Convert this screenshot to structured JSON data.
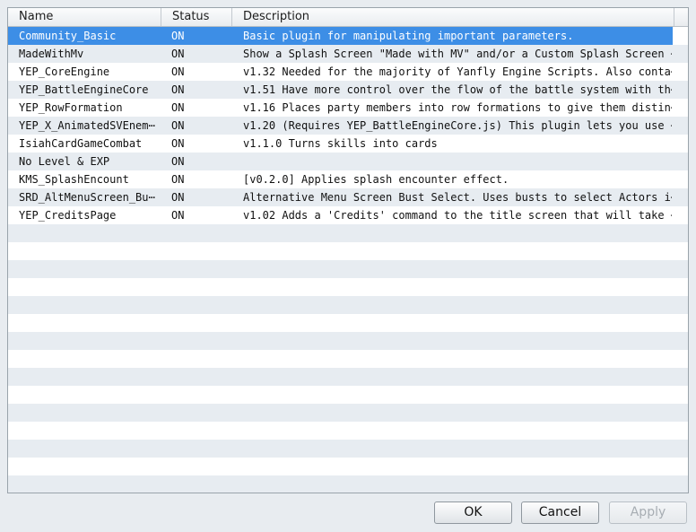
{
  "columns": {
    "name": "Name",
    "status": "Status",
    "description": "Description"
  },
  "plugins": [
    {
      "name": "Community_Basic",
      "status": "ON",
      "description": "Basic plugin for manipulating important parameters.",
      "selected": true
    },
    {
      "name": "MadeWithMv",
      "status": "ON",
      "description": "Show a Splash Screen \"Made with MV\" and/or a Custom Splash Screen ⋯"
    },
    {
      "name": "YEP_CoreEngine",
      "status": "ON",
      "description": "v1.32 Needed for the majority of Yanfly Engine Scripts. Also conta⋯"
    },
    {
      "name": "YEP_BattleEngineCore",
      "status": "ON",
      "description": "v1.51 Have more control over the flow of the battle system with th⋯"
    },
    {
      "name": "YEP_RowFormation",
      "status": "ON",
      "description": "v1.16 Places party members into row formations to give them distin⋯"
    },
    {
      "name": "YEP_X_AnimatedSVEnem⋯",
      "status": "ON",
      "description": "v1.20 (Requires YEP_BattleEngineCore.js) This plugin lets you use ⋯"
    },
    {
      "name": "IsiahCardGameCombat",
      "status": "ON",
      "description": "v1.1.0 Turns skills into cards"
    },
    {
      "name": "No Level & EXP",
      "status": "ON",
      "description": ""
    },
    {
      "name": "KMS_SplashEncount",
      "status": "ON",
      "description": "[v0.2.0] Applies splash encounter effect."
    },
    {
      "name": "SRD_AltMenuScreen_Bu⋯",
      "status": "ON",
      "description": "Alternative Menu Screen Bust Select. Uses busts to select Actors i⋯"
    },
    {
      "name": "YEP_CreditsPage",
      "status": "ON",
      "description": "v1.02 Adds a 'Credits' command to the title screen that will take ⋯"
    }
  ],
  "buttons": {
    "ok": "OK",
    "cancel": "Cancel",
    "apply": "Apply"
  }
}
